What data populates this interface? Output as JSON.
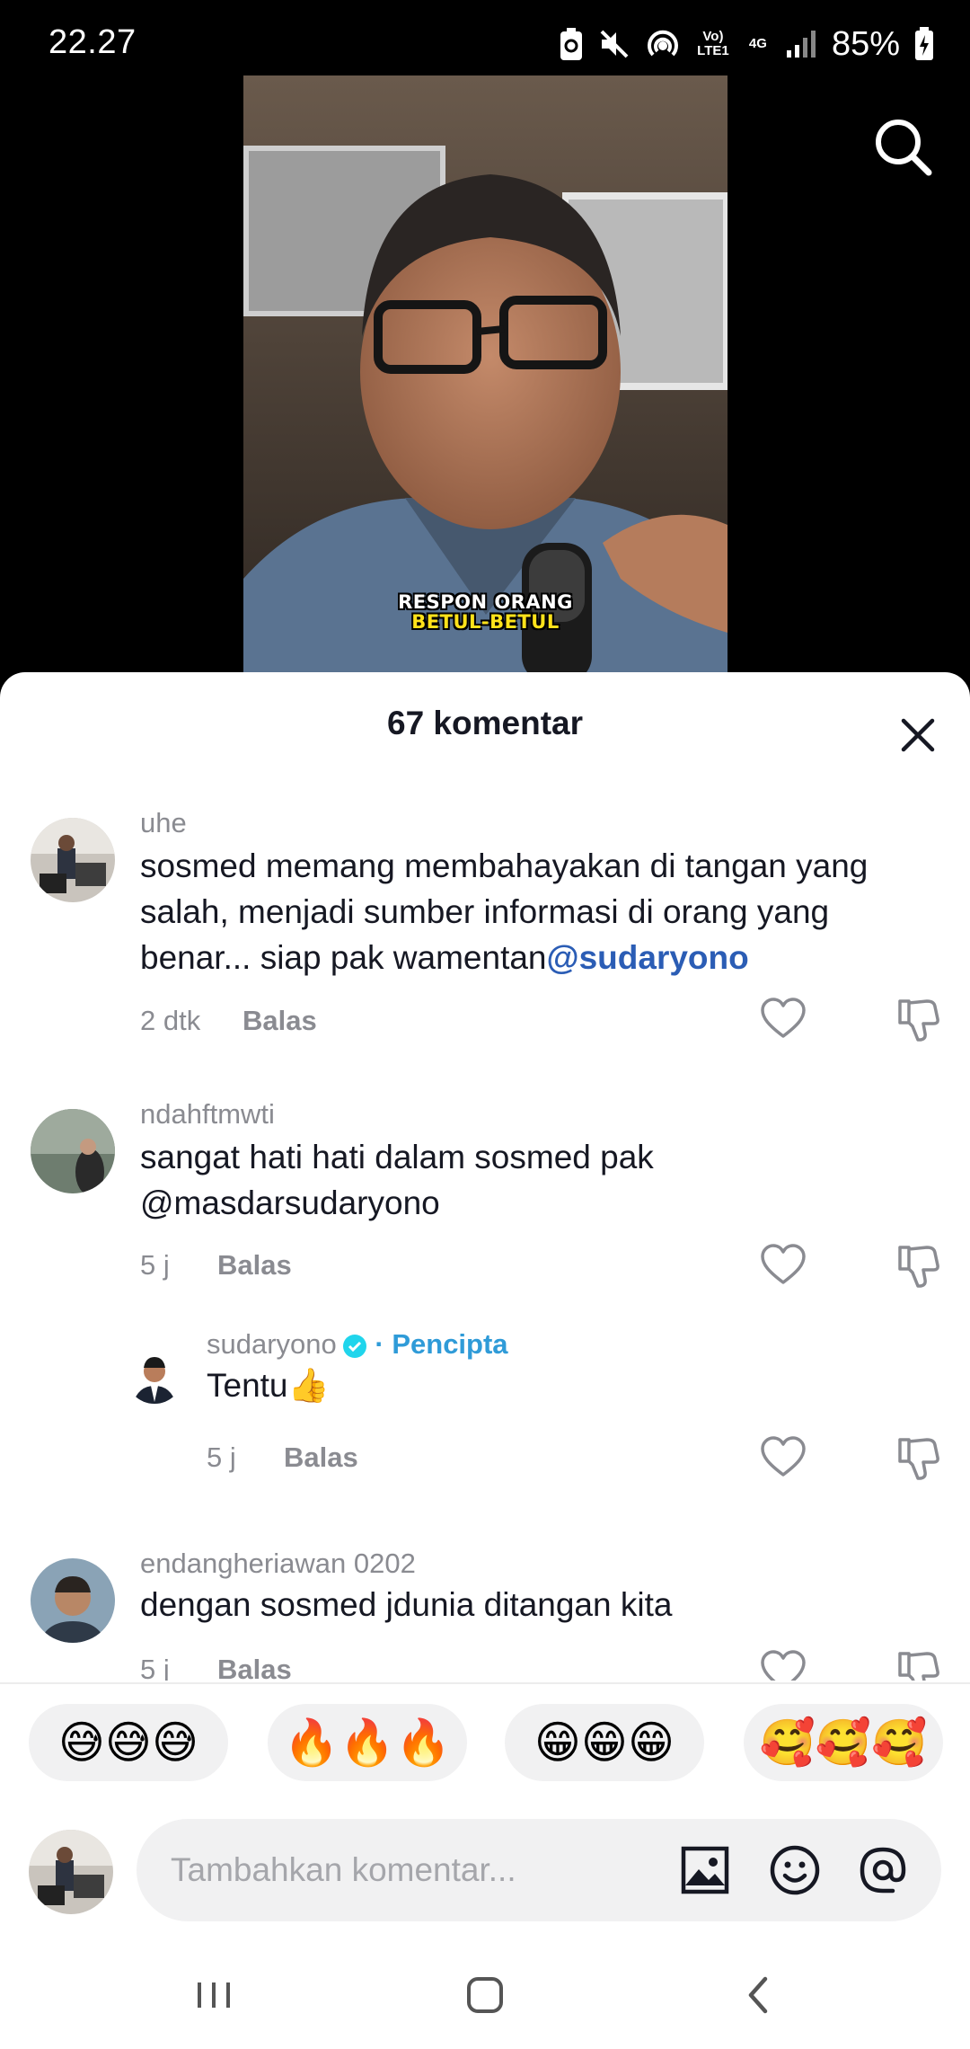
{
  "status": {
    "time": "22.27",
    "net_top": "Vo) LTE1",
    "net_gen": "4G",
    "battery": "85%"
  },
  "video": {
    "caption_line1": "RESPON ORANG",
    "caption_line2": "BETUL-BETUL"
  },
  "sheet": {
    "title": "67 komentar"
  },
  "comments": [
    {
      "user": "uhe",
      "text": "sosmed memang membahayakan di tangan yang salah, menjadi sumber informasi di orang yang benar... siap pak wamentan",
      "mention": "@sudaryono",
      "time": "2 dtk",
      "reply": "Balas"
    },
    {
      "user": "ndahftmwti",
      "text": "sangat hati hati dalam sosmed pak @masdarsudaryono",
      "time": "5 j",
      "reply": "Balas"
    },
    {
      "user": "sudaryono",
      "badge": "· Pencipta",
      "text": "Tentu👍",
      "time": "5 j",
      "reply": "Balas"
    },
    {
      "user": "endangheriawan 0202",
      "text": "dengan sosmed jdunia ditangan kita",
      "time": "5 j",
      "reply": "Balas"
    }
  ],
  "quick_emojis": [
    "😅😅😅",
    "🔥🔥🔥",
    "😁😁😁",
    "🥰🥰🥰"
  ],
  "input": {
    "placeholder": "Tambahkan komentar..."
  },
  "icons": {
    "search": "search-icon",
    "close": "close-icon",
    "like": "heart-outline-icon",
    "dislike": "thumbs-down-icon",
    "image": "image-icon",
    "emoji": "smiley-icon",
    "mention": "at-sign-icon"
  },
  "colors": {
    "mention": "#2b5db5",
    "creator": "#2f9bd8",
    "muted": "#8a8b91",
    "text": "#161823"
  }
}
